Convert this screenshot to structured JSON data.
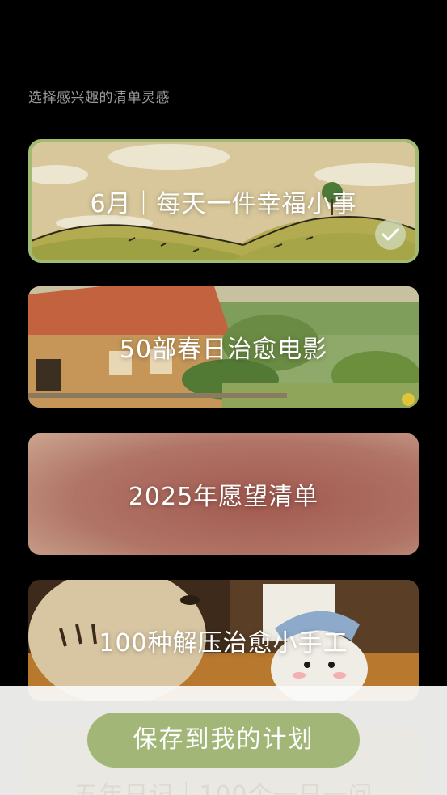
{
  "header": {
    "subtitle": "选择感兴趣的清单灵感"
  },
  "cards": [
    {
      "title": "6月｜每天一件幸福小事",
      "selected": true
    },
    {
      "title": "50部春日治愈电影",
      "selected": false
    },
    {
      "title": "2025年愿望清单",
      "selected": false
    },
    {
      "title": "100种解压治愈小手工",
      "selected": false
    },
    {
      "title": "五年日记｜100个一日一问",
      "selected": false
    }
  ],
  "footer": {
    "save_label": "保存到我的计划"
  },
  "colors": {
    "accent": "#a2bb71",
    "button": "#a2b678",
    "background": "#000000"
  }
}
